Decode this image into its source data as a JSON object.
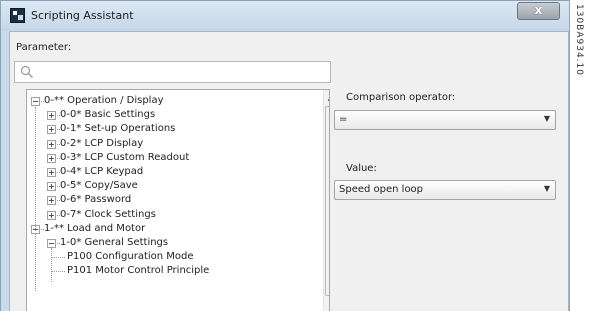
{
  "window": {
    "title": "Scripting Assistant",
    "close_glyph": "x"
  },
  "parameter": {
    "label": "Parameter:",
    "search_placeholder": "",
    "icon": "search-icon"
  },
  "tree": {
    "items": [
      {
        "label": "0-** Operation / Display",
        "level": 0,
        "expander": "minus"
      },
      {
        "label": "0-0* Basic Settings",
        "level": 1,
        "expander": "plus"
      },
      {
        "label": "0-1* Set-up Operations",
        "level": 1,
        "expander": "plus"
      },
      {
        "label": "0-2* LCP Display",
        "level": 1,
        "expander": "plus"
      },
      {
        "label": "0-3* LCP Custom Readout",
        "level": 1,
        "expander": "plus"
      },
      {
        "label": "0-4* LCP Keypad",
        "level": 1,
        "expander": "plus"
      },
      {
        "label": "0-5* Copy/Save",
        "level": 1,
        "expander": "plus"
      },
      {
        "label": "0-6* Password",
        "level": 1,
        "expander": "plus"
      },
      {
        "label": "0-7* Clock Settings",
        "level": 1,
        "expander": "plus"
      },
      {
        "label": "1-** Load and Motor",
        "level": 0,
        "expander": "minus"
      },
      {
        "label": "1-0* General Settings",
        "level": 1,
        "expander": "minus"
      },
      {
        "label": "P100 Configuration Mode",
        "level": 2,
        "expander": "none"
      },
      {
        "label": "P101 Motor Control Principle",
        "level": 2,
        "expander": "none"
      }
    ]
  },
  "comparison": {
    "label": "Comparison operator:",
    "selected": "="
  },
  "value": {
    "label": "Value:",
    "selected": "Speed open loop"
  },
  "side_code": "130BA934.10"
}
